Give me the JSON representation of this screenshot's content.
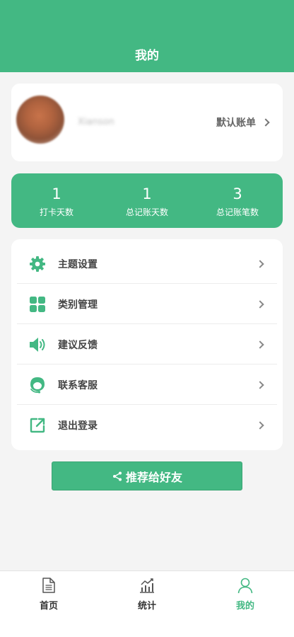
{
  "header": {
    "title": "我的"
  },
  "profile": {
    "username": "Xianson",
    "default_ledger_label": "默认账单"
  },
  "stats": [
    {
      "value": "1",
      "label": "打卡天数"
    },
    {
      "value": "1",
      "label": "总记账天数"
    },
    {
      "value": "3",
      "label": "总记账笔数"
    }
  ],
  "menu": [
    {
      "label": "主题设置",
      "icon": "gear-icon"
    },
    {
      "label": "类别管理",
      "icon": "grid-icon"
    },
    {
      "label": "建议反馈",
      "icon": "speaker-icon"
    },
    {
      "label": "联系客服",
      "icon": "customer-service-icon"
    },
    {
      "label": "退出登录",
      "icon": "logout-icon"
    }
  ],
  "share_button": {
    "label": "推荐给好友",
    "icon": "share-icon"
  },
  "tabbar": {
    "items": [
      {
        "label": "首页",
        "icon": "document-icon"
      },
      {
        "label": "统计",
        "icon": "chart-icon"
      },
      {
        "label": "我的",
        "icon": "person-icon"
      }
    ],
    "active_index": 2
  },
  "colors": {
    "accent": "#43b883",
    "background": "#f4f4f4"
  }
}
